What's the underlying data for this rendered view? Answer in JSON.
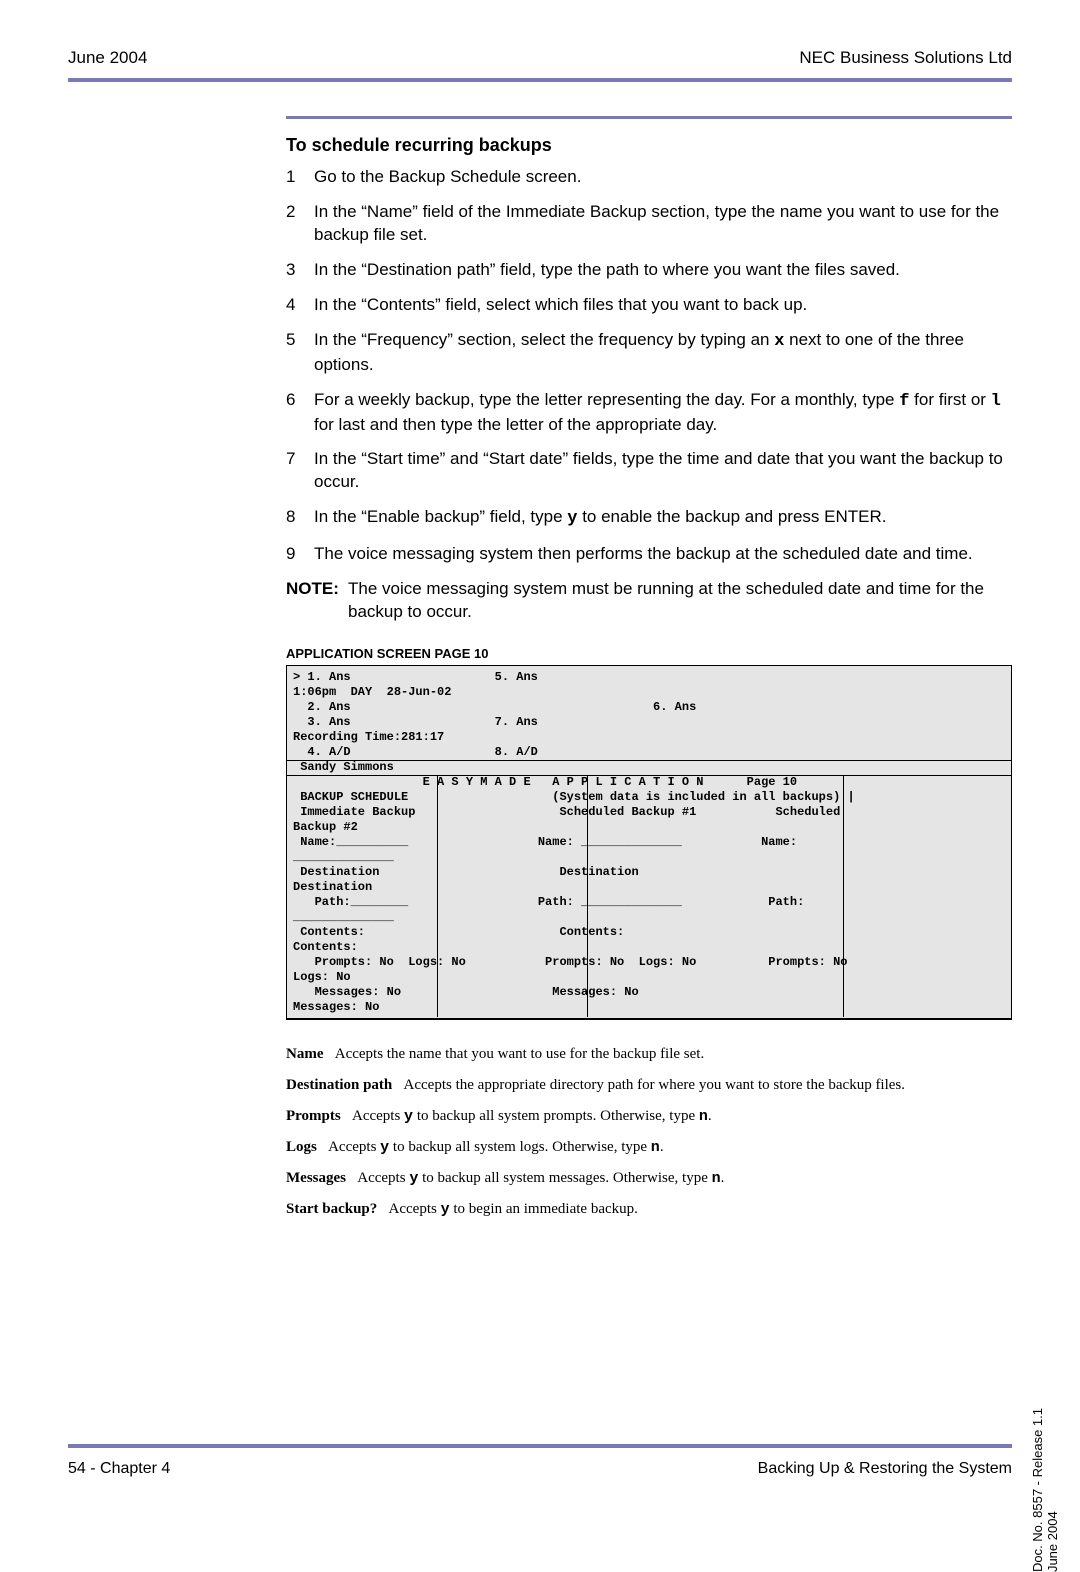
{
  "header": {
    "left": "June 2004",
    "right": "NEC Business Solutions Ltd"
  },
  "section": {
    "heading": "To schedule recurring backups",
    "steps": [
      "Go to the Backup Schedule screen.",
      "In the “Name” field of the Immediate Backup section, type the name you want to use for the backup file set.",
      "In the “Destination path” field, type the path to where you want the files saved.",
      "In the “Contents” field, select which files that you want to back up.",
      {
        "pre": "In the “Frequency” section, select the frequency by typing an ",
        "code": "x",
        "post": " next to one of the three options."
      },
      {
        "pre": "For a weekly backup, type the letter representing the day. For a monthly, type ",
        "code": "f",
        "mid": " for first or ",
        "code2": "l",
        "post": " for last and then type the letter of the appropriate day."
      },
      "In the “Start time” and “Start date” fields, type the time and date that you want the backup to occur.",
      {
        "pre": "In the “Enable backup” field, type ",
        "code": "y",
        "post": " to enable the backup and press ENTER."
      },
      "The voice messaging system then performs the backup at the scheduled date and time."
    ],
    "note_label": "NOTE:",
    "note_text": "The voice messaging system must be running at the scheduled date and time for the backup to occur."
  },
  "screen": {
    "title": "APPLICATION SCREEN PAGE 10",
    "body": "> 1. Ans                    5. Ans\n1:06pm  DAY  28-Jun-02\n  2. Ans                                          6. Ans\n  3. Ans                    7. Ans\nRecording Time:281:17\n  4. A/D                    8. A/D\n Sandy Simmons\n                  E A S Y M A D E   A P P L I C A T I O N      Page 10\n BACKUP SCHEDULE                    (System data is included in all backups) |\n Immediate Backup                    Scheduled Backup #1           Scheduled\nBackup #2\n Name:__________                  Name: ______________           Name:\n______________\n Destination                         Destination\nDestination\n   Path:________                  Path: ______________            Path:\n______________\n Contents:                           Contents:\nContents:\n   Prompts: No  Logs: No           Prompts: No  Logs: No          Prompts: No\nLogs: No\n   Messages: No                     Messages: No\nMessages: No"
  },
  "fields": {
    "name": {
      "label": "Name",
      "text": "Accepts the name that you want to use for the backup file set."
    },
    "destpath": {
      "label": "Destination path",
      "text": "Accepts the appropriate directory path for where you want to store the backup files."
    },
    "prompts": {
      "label": "Prompts",
      "pre": "Accepts ",
      "y": "y",
      "mid": " to backup all system prompts. Otherwise, type  ",
      "n": "n",
      "post": "."
    },
    "logs": {
      "label": "Logs",
      "pre": "Accepts ",
      "y": "y",
      "mid": " to backup all system logs. Otherwise, type  ",
      "n": "n",
      "post": "."
    },
    "messages": {
      "label": "Messages",
      "pre": "Accepts ",
      "y": "y",
      "mid": " to backup all system messages. Otherwise, type  ",
      "n": "n",
      "post": "."
    },
    "start": {
      "label": "Start backup?",
      "pre": "Accepts ",
      "y": "y",
      "post": " to begin an immediate backup."
    }
  },
  "side": {
    "line1": "Doc. No. 8557 - Release 1.1",
    "line2": "June 2004"
  },
  "footer": {
    "left": "54 - Chapter 4",
    "right": "Backing Up & Restoring the System"
  }
}
